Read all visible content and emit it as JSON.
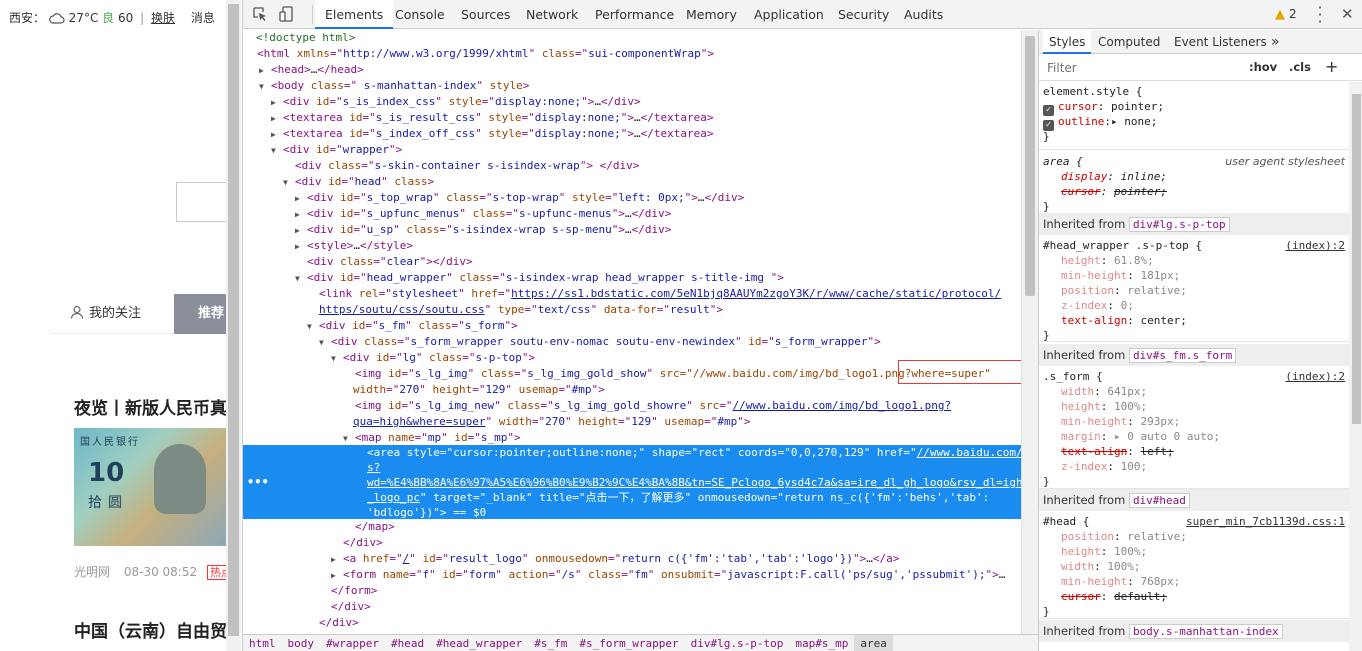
{
  "page": {
    "weather": {
      "city": "西安：",
      "temp": "27°C",
      "aqi_label": "良",
      "aqi_value": "60",
      "sep": "|",
      "skin_link": "换肤",
      "msg": "消息"
    },
    "feed_tabs": {
      "mine": "我的关注",
      "rec": "推荐"
    },
    "news": [
      {
        "title": "夜览丨新版人民币真"
      },
      {
        "title": "中国（云南）自由贸"
      }
    ],
    "banknote": {
      "header": "国人民银行",
      "value": "10",
      "yuan": "拾圆"
    },
    "meta": {
      "source": "光明网",
      "time": "08-30 08:52",
      "badge": "热点"
    }
  },
  "devtools": {
    "tabs": [
      "Elements",
      "Console",
      "Sources",
      "Network",
      "Performance",
      "Memory",
      "Application",
      "Security",
      "Audits"
    ],
    "warning_count": "2",
    "breadcrumb": [
      "html",
      "body",
      "#wrapper",
      "#head",
      "#head_wrapper",
      "#s_fm",
      "#s_form_wrapper",
      "div#lg.s-p-top",
      "map#s_mp",
      "area"
    ],
    "annotation": "src=\"//www.baidu.com/img/bd_logo1.png?where=super\""
  },
  "styles": {
    "tabs": [
      "Styles",
      "Computed",
      "Event Listeners"
    ],
    "more": "»",
    "filter_placeholder": "Filter",
    "hov": ":hov",
    "cls": ".cls",
    "plus": "+",
    "element_style": {
      "selector": "element.style {",
      "props": [
        {
          "n": "cursor",
          "v": "pointer;"
        },
        {
          "n": "outline",
          "v": "none;"
        }
      ],
      "close": "}"
    },
    "area_rule": {
      "selector": "area {",
      "source": "user agent stylesheet",
      "p1n": "display",
      "p1v": "inline;",
      "p2n": "cursor",
      "p2v": "pointer;",
      "close": "}"
    },
    "inherited_label": "Inherited from",
    "inh1": {
      "chip": "div#lg.s-p-top",
      "selector": "#head_wrapper .s-p-top {",
      "source": "(index):2",
      "props": [
        {
          "n": "height",
          "v": "61.8%;"
        },
        {
          "n": "min-height",
          "v": "181px;"
        },
        {
          "n": "position",
          "v": "relative;"
        },
        {
          "n": "z-index",
          "v": "0;"
        },
        {
          "n": "text-align",
          "v": "center;"
        }
      ]
    },
    "inh2": {
      "chip": "div#s_fm.s_form",
      "selector": ".s_form {",
      "source": "(index):2",
      "props": [
        {
          "n": "width",
          "v": "641px;"
        },
        {
          "n": "height",
          "v": "100%;"
        },
        {
          "n": "min-height",
          "v": "293px;"
        },
        {
          "n": "margin",
          "v": "▸ 0 auto 0 auto;"
        },
        {
          "n": "text-align",
          "v": "left;"
        },
        {
          "n": "z-index",
          "v": "100;"
        }
      ]
    },
    "inh3": {
      "chip": "div#head",
      "selector": "#head {",
      "source": "super_min_7cb1139d.css:1",
      "props": [
        {
          "n": "position",
          "v": "relative;"
        },
        {
          "n": "height",
          "v": "100%;"
        },
        {
          "n": "width",
          "v": "100%;"
        },
        {
          "n": "min-height",
          "v": "768px;"
        },
        {
          "n": "cursor",
          "v": "default;"
        }
      ]
    },
    "inh4": {
      "chip": "body.s-manhattan-index"
    },
    "close": "}"
  }
}
